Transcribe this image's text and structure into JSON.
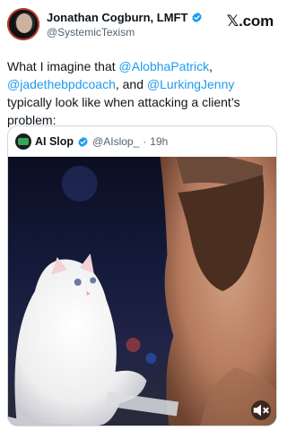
{
  "author": {
    "name": "Jonathan Cogburn, LMFT",
    "handle": "@SystemicTexism"
  },
  "brand": "𝕏.com",
  "tweet": {
    "text_start": "What I imagine that ",
    "mention1": "@AlobhaPatrick",
    "sep1": ",",
    "mention2": "@jadethebpdcoach",
    "sep2": ", and ",
    "mention3": "@LurkingJenny",
    "text_end": " typically look like when attacking a client’s problem:"
  },
  "quote": {
    "name": "AI Slop",
    "handle": "@AIslop_",
    "separator": "·",
    "time": "19h"
  },
  "colors": {
    "verified": "#1d9bf0",
    "mention": "#1d9bf0"
  },
  "icons": {
    "verified": "verified-badge-icon",
    "mute": "mute-icon"
  }
}
